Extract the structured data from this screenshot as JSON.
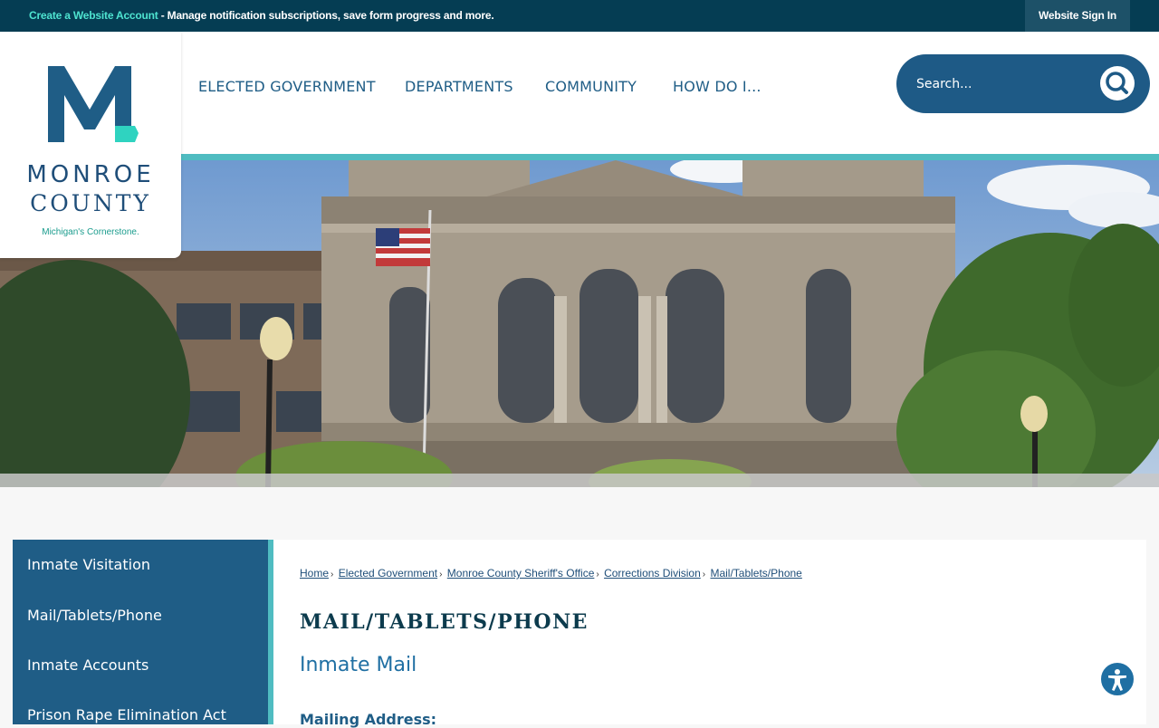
{
  "topbar": {
    "create_link": "Create a Website Account",
    "create_desc": " - Manage notification subscriptions, save form progress and more.",
    "signin": "Website Sign In"
  },
  "logo": {
    "line1": "MONROE",
    "line2": "COUNTY",
    "tagline": "Michigan's Cornerstone."
  },
  "nav": {
    "items": [
      "ELECTED GOVERNMENT",
      "DEPARTMENTS",
      "COMMUNITY",
      "HOW DO I..."
    ]
  },
  "search": {
    "placeholder": "Search..."
  },
  "sidebar": {
    "items": [
      "Inmate Visitation",
      "Mail/Tablets/Phone",
      "Inmate Accounts",
      "Prison Rape Elimination Act"
    ]
  },
  "breadcrumb": {
    "items": [
      "Home",
      "Elected Government",
      "Monroe County Sheriff's Office",
      "Corrections Division",
      "Mail/Tablets/Phone"
    ]
  },
  "content": {
    "title": "MAIL/TABLETS/PHONE",
    "subtitle": "Inmate Mail",
    "mailing_label": "Mailing Address:"
  },
  "colors": {
    "topbar": "#053d53",
    "accent_teal": "#4fbcc1",
    "brand_blue": "#1f5d86"
  },
  "icons": {
    "search": "search-icon",
    "accessibility": "accessibility-icon"
  }
}
